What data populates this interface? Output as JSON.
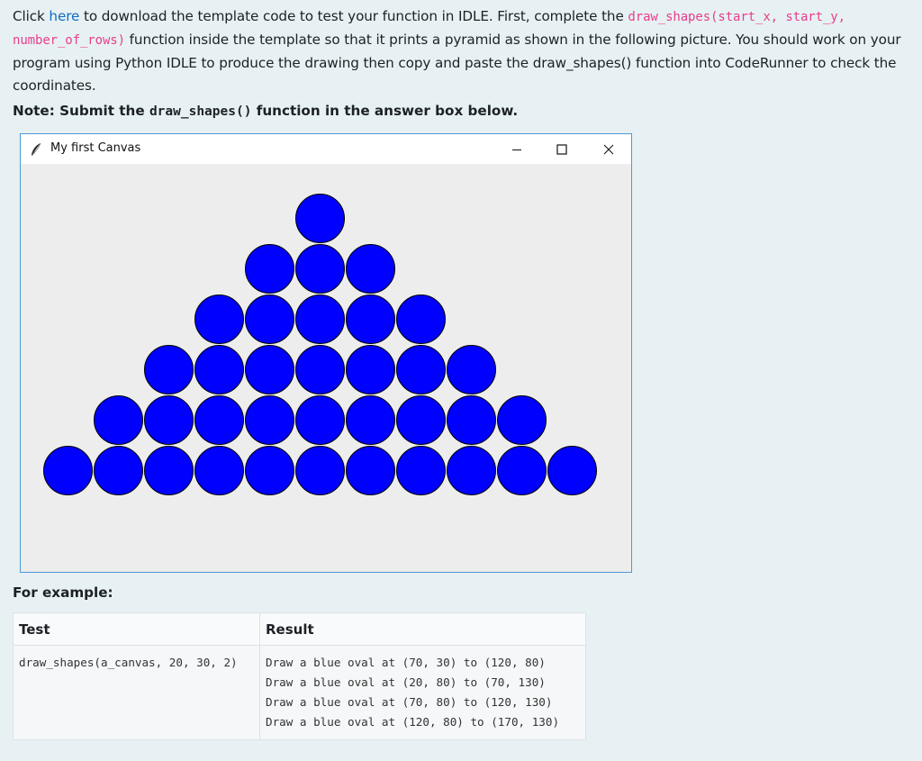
{
  "intro": {
    "p1": "Click ",
    "link": "here",
    "p2": " to download the template code to test your function in IDLE.   First, complete the ",
    "code1": "draw_shapes(start_x, start_y, number_of_rows)",
    "p3": " function inside the template so that it prints a pyramid as shown in the following picture. You should work on your program using Python IDLE to produce the drawing then copy and paste the draw_shapes() function into CodeRunner to check the coordinates."
  },
  "note": {
    "prefix": "Note: Submit the ",
    "code": "draw_shapes()",
    "suffix": " function in the answer box below."
  },
  "window": {
    "title": "My first Canvas",
    "minimize_icon": "minimize-icon",
    "maximize_icon": "maximize-icon",
    "close_icon": "close-icon",
    "circle_color": "#0000ff",
    "rows": 6
  },
  "example_label": "For example:",
  "table": {
    "headers": [
      "Test",
      "Result"
    ],
    "test": "draw_shapes(a_canvas, 20, 30, 2)",
    "results": [
      "Draw a blue oval at (70, 30) to (120, 80)",
      "Draw a blue oval at (20, 80) to (70, 130)",
      "Draw a blue oval at (70, 80) to (120, 130)",
      "Draw a blue oval at (120, 80) to (170, 130)"
    ]
  }
}
